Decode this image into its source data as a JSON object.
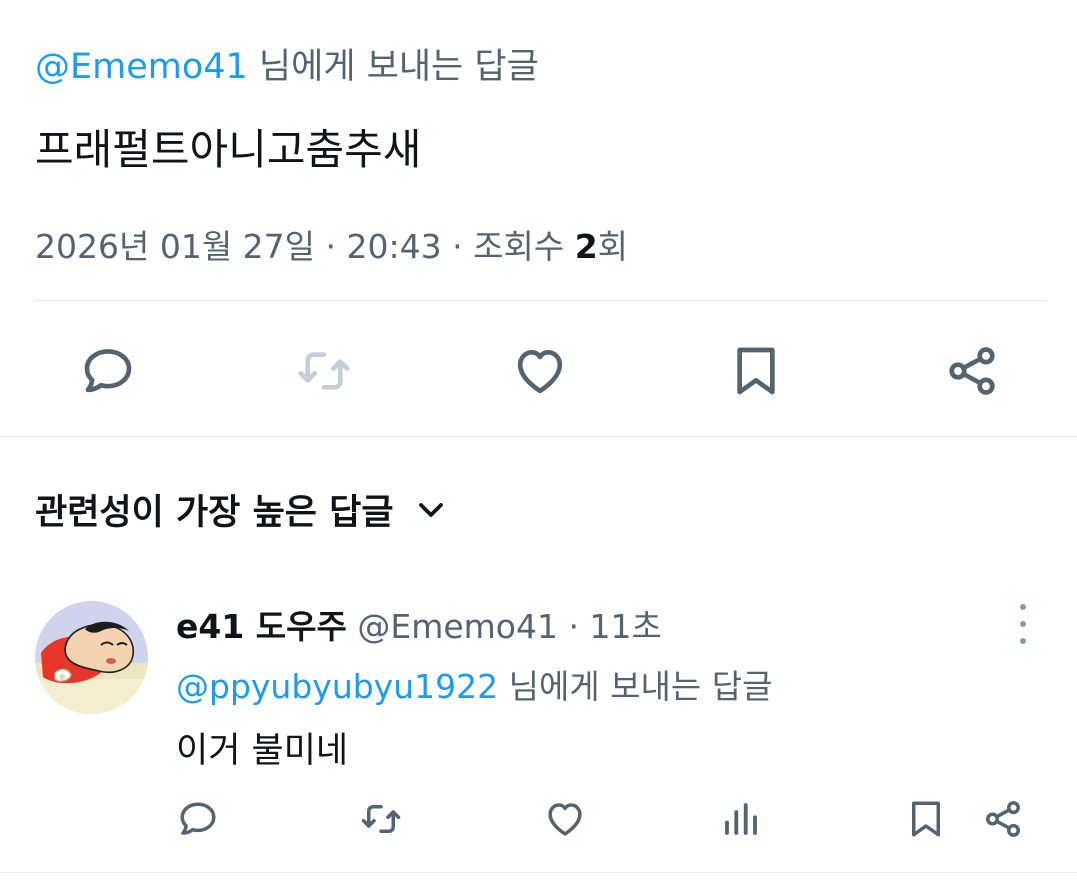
{
  "tweet": {
    "reply_to_handle": "@Ememo41",
    "reply_to_suffix": " 님에게 보내는 답글",
    "text": "프래펄트아니고춤추새",
    "date": "2026년 01월 27일",
    "sep1": " · ",
    "time": "20:43",
    "sep2": " · ",
    "views_label": "조회수 ",
    "views_count": "2",
    "views_unit": "회"
  },
  "actions": {
    "reply_icon": "reply-bubble-icon",
    "retweet_icon": "retweet-icon",
    "like_icon": "heart-icon",
    "bookmark_icon": "bookmark-icon",
    "share_icon": "share-icon"
  },
  "sort": {
    "label": "관련성이 가장 높은 답글",
    "icon": "chevron-down-icon"
  },
  "reply": {
    "display_name": "e41 도우주",
    "handle": " @Ememo41",
    "sep": " · ",
    "time": "11초",
    "reply_to_handle": "@ppyubyubyu1922",
    "reply_to_suffix": " 님에게 보내는 답글",
    "text": "이거 불미네"
  },
  "colors": {
    "text_primary": "#0f1419",
    "text_secondary": "#536471",
    "accent": "#1d9bf0",
    "icon": "#536471",
    "icon_disabled": "#c4ced6",
    "divider": "#e4e8eb"
  }
}
